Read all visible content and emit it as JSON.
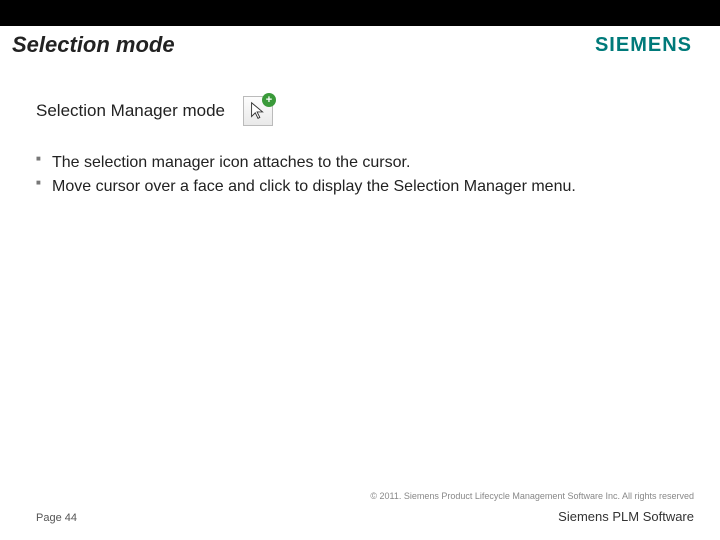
{
  "header": {
    "title": "Selection mode",
    "logo": "SIEMENS"
  },
  "subhead": {
    "text": "Selection Manager mode",
    "icon_name": "selection-manager-cursor-icon",
    "badge": "+"
  },
  "bullets": [
    "The selection manager icon attaches to the cursor.",
    " Move cursor over a face and click to display the Selection Manager menu."
  ],
  "footer": {
    "copyright": "© 2011. Siemens Product Lifecycle Management Software Inc. All rights reserved",
    "page": "Page 44",
    "brand": "Siemens PLM Software"
  }
}
